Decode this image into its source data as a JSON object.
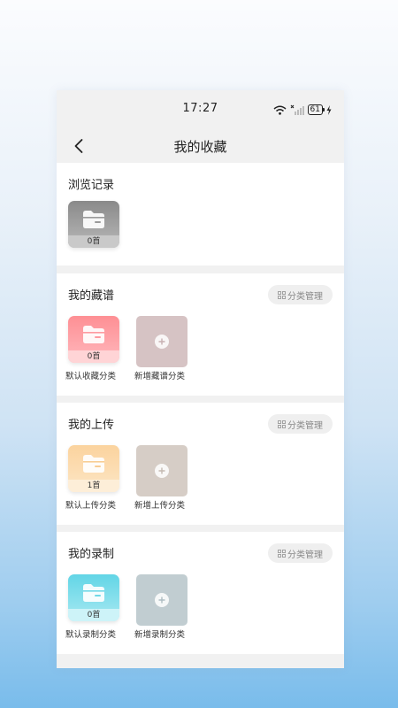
{
  "status_bar": {
    "time": "17:27",
    "battery": "61"
  },
  "nav": {
    "title": "我的收藏"
  },
  "history": {
    "title": "浏览记录",
    "tile_count": "0首"
  },
  "sections": [
    {
      "title": "我的藏谱",
      "manage_label": "分类管理",
      "default_count": "0首",
      "default_label": "默认收藏分类",
      "add_label": "新增藏谱分类",
      "tile_color_top": "#fe8f94",
      "tile_color_bottom": "#ffb8bd",
      "add_color": "#d6c3c4"
    },
    {
      "title": "我的上传",
      "manage_label": "分类管理",
      "default_count": "1首",
      "default_label": "默认上传分类",
      "add_label": "新增上传分类",
      "tile_color_top": "#fbd39e",
      "tile_color_bottom": "#fde6c5",
      "add_color": "#d6cdc6"
    },
    {
      "title": "我的录制",
      "manage_label": "分类管理",
      "default_count": "0首",
      "default_label": "默认录制分类",
      "add_label": "新增录制分类",
      "tile_color_top": "#62d5e6",
      "tile_color_bottom": "#a8e9f2",
      "add_color": "#c1cdd1"
    }
  ]
}
